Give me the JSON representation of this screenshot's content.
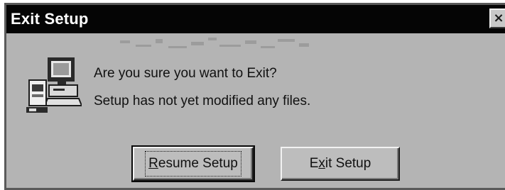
{
  "window": {
    "title": "Exit Setup",
    "close_glyph": "×"
  },
  "message": {
    "line1": "Are you sure you want to Exit?",
    "line2": "Setup has not yet modified any files."
  },
  "icon": "setup-computer-icon",
  "buttons": {
    "resume": {
      "mnemonic": "R",
      "rest": "esume Setup"
    },
    "exit": {
      "pre": "E",
      "mnemonic": "x",
      "rest": "it Setup"
    }
  },
  "colors": {
    "titlebar": "#050505",
    "dialog_face": "#b4b4b4"
  }
}
